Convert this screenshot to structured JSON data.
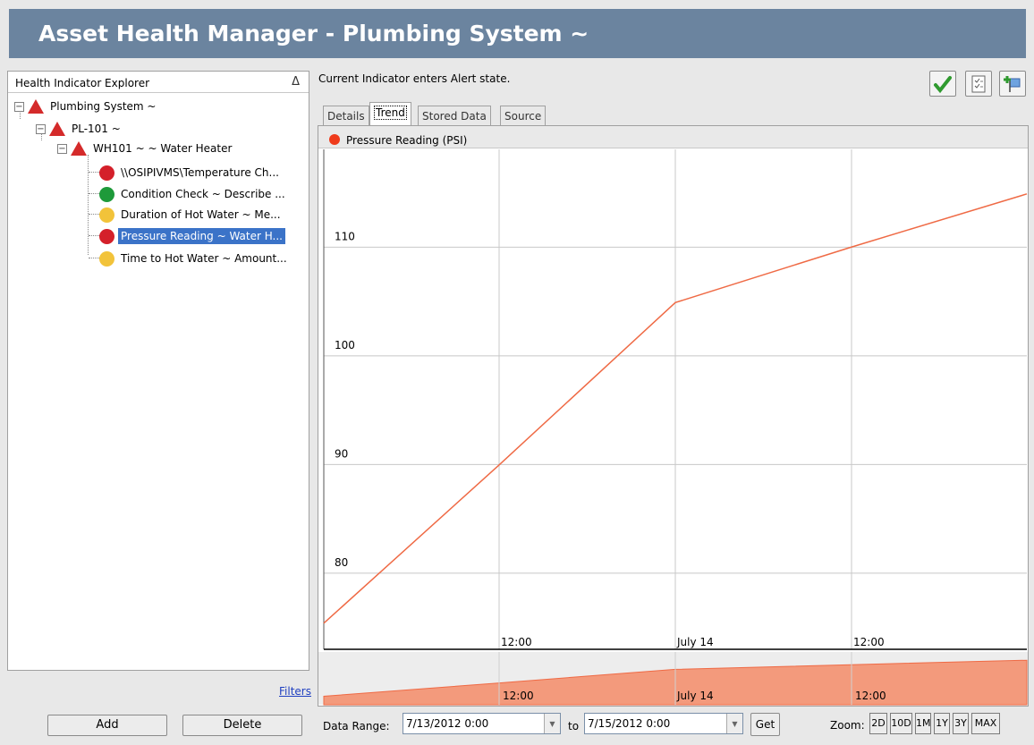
{
  "window": {
    "title": "Asset Health Manager - Plumbing System ~"
  },
  "explorer": {
    "title": "Health Indicator Explorer",
    "collapse_glyph": "Δ",
    "tree": [
      {
        "label": "Plumbing System ~",
        "icon": "red-triangle-icon",
        "expander": "−"
      },
      {
        "label": "PL-101 ~",
        "icon": "red-triangle-icon",
        "expander": "−"
      },
      {
        "label": "WH101 ~  ~ Water Heater",
        "icon": "red-triangle-icon",
        "expander": "−"
      },
      {
        "label": "\\\\OSIPIVMS\\Temperature Ch...",
        "icon": "red-circle-icon",
        "status": "red"
      },
      {
        "label": "Condition Check ~ Describe ...",
        "icon": "green-circle-icon",
        "status": "green"
      },
      {
        "label": "Duration of Hot Water ~ Me...",
        "icon": "yellow-circle-icon",
        "status": "yellow"
      },
      {
        "label": "Pressure Reading ~ Water H...",
        "icon": "red-circle-icon",
        "status": "red",
        "selected": true
      },
      {
        "label": "Time to Hot Water ~ Amount...",
        "icon": "yellow-circle-icon",
        "status": "yellow"
      }
    ],
    "filters_label": "Filters",
    "add_label": "Add",
    "delete_label": "Delete"
  },
  "status": {
    "text": "Current Indicator enters Alert state."
  },
  "toolbar": {
    "icons": [
      "checkmark-icon",
      "checklist-icon",
      "add-flag-icon"
    ]
  },
  "tabs": [
    {
      "label": "Details",
      "active": false
    },
    {
      "label": "Trend",
      "active": true
    },
    {
      "label": "Stored Data",
      "active": false
    },
    {
      "label": "Source",
      "active": false
    }
  ],
  "colors": {
    "series": "#ef6a45",
    "legend_dot": "#ef3b1b",
    "selection": "#3b73c8",
    "title_bar": "#6b849f"
  },
  "chart_data": {
    "type": "line",
    "legend": "Pressure Reading (PSI)",
    "x_tick_labels": [
      "12:00",
      "July 14",
      "12:00"
    ],
    "y_tick_labels": [
      "110",
      "100",
      "90",
      "80"
    ],
    "x_unit": "hours from 7/13/2012 0:00",
    "points": [
      {
        "x": 0,
        "y": 75.4
      },
      {
        "x": 12,
        "y": 90
      },
      {
        "x": 24,
        "y": 104.9
      },
      {
        "x": 36,
        "y": 110
      },
      {
        "x": 48,
        "y": 114.9
      }
    ],
    "ylim": [
      73,
      119
    ],
    "xlim": [
      0,
      48
    ],
    "grid": true,
    "overview_x_tick_labels": [
      "12:00",
      "July 14",
      "12:00"
    ]
  },
  "range": {
    "label": "Data Range:",
    "from": "7/13/2012 0:00",
    "to_label": "to",
    "to": "7/15/2012 0:00",
    "get_label": "Get"
  },
  "zoom": {
    "label": "Zoom:",
    "buttons": [
      "2D",
      "10D",
      "1M",
      "1Y",
      "3Y",
      "MAX"
    ]
  }
}
